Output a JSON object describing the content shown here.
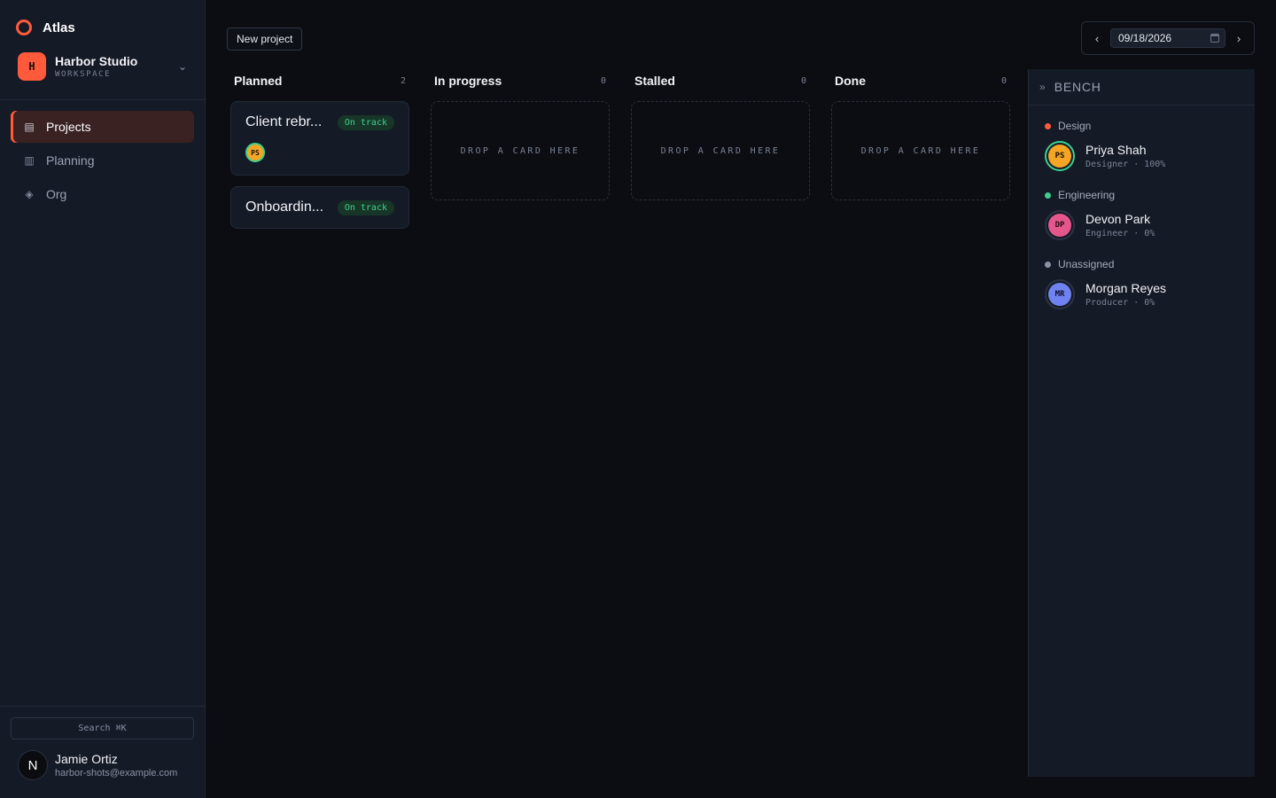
{
  "app": {
    "name": "Atlas"
  },
  "workspace": {
    "initial": "H",
    "name": "Harbor Studio",
    "subtitle": "WORKSPACE"
  },
  "nav": [
    {
      "label": "Projects",
      "icon": "list-icon",
      "glyph": "▤",
      "active": true
    },
    {
      "label": "Planning",
      "icon": "columns-icon",
      "glyph": "▥",
      "active": false
    },
    {
      "label": "Org",
      "icon": "diamond-icon",
      "glyph": "◈",
      "active": false
    }
  ],
  "search": {
    "label": "Search ⌘K"
  },
  "user": {
    "initial": "N",
    "name": "Jamie Ortiz",
    "email": "harbor-shots@example.com"
  },
  "toolbar": {
    "new_project": "New project",
    "prev": "‹",
    "next": "›",
    "date": "09/18/2026"
  },
  "board": {
    "drop_label": "DROP A CARD HERE",
    "columns": [
      {
        "title": "Planned",
        "count": "2"
      },
      {
        "title": "In progress",
        "count": "0"
      },
      {
        "title": "Stalled",
        "count": "0"
      },
      {
        "title": "Done",
        "count": "0"
      }
    ],
    "cards": [
      {
        "title": "Client rebr...",
        "status": "On track",
        "assignee": "PS"
      },
      {
        "title": "Onboardin...",
        "status": "On track",
        "assignee": ""
      }
    ]
  },
  "bench": {
    "title": "BENCH",
    "chevron": "»",
    "groups": [
      {
        "label": "Design",
        "color": "#ff5a3c",
        "people": [
          {
            "initials": "PS",
            "name": "Priya Shah",
            "role": "Designer",
            "allocation": "100%",
            "avatar_color": "#f5a524",
            "ring": "#3ecf8e"
          }
        ]
      },
      {
        "label": "Engineering",
        "color": "#3ecf8e",
        "people": [
          {
            "initials": "DP",
            "name": "Devon Park",
            "role": "Engineer",
            "allocation": "0%",
            "avatar_color": "#e4578d",
            "ring": "#2b3242"
          }
        ]
      },
      {
        "label": "Unassigned",
        "color": "#8a92a4",
        "people": [
          {
            "initials": "MR",
            "name": "Morgan Reyes",
            "role": "Producer",
            "allocation": "0%",
            "avatar_color": "#6f82f0",
            "ring": "#2b3242"
          }
        ]
      }
    ]
  }
}
